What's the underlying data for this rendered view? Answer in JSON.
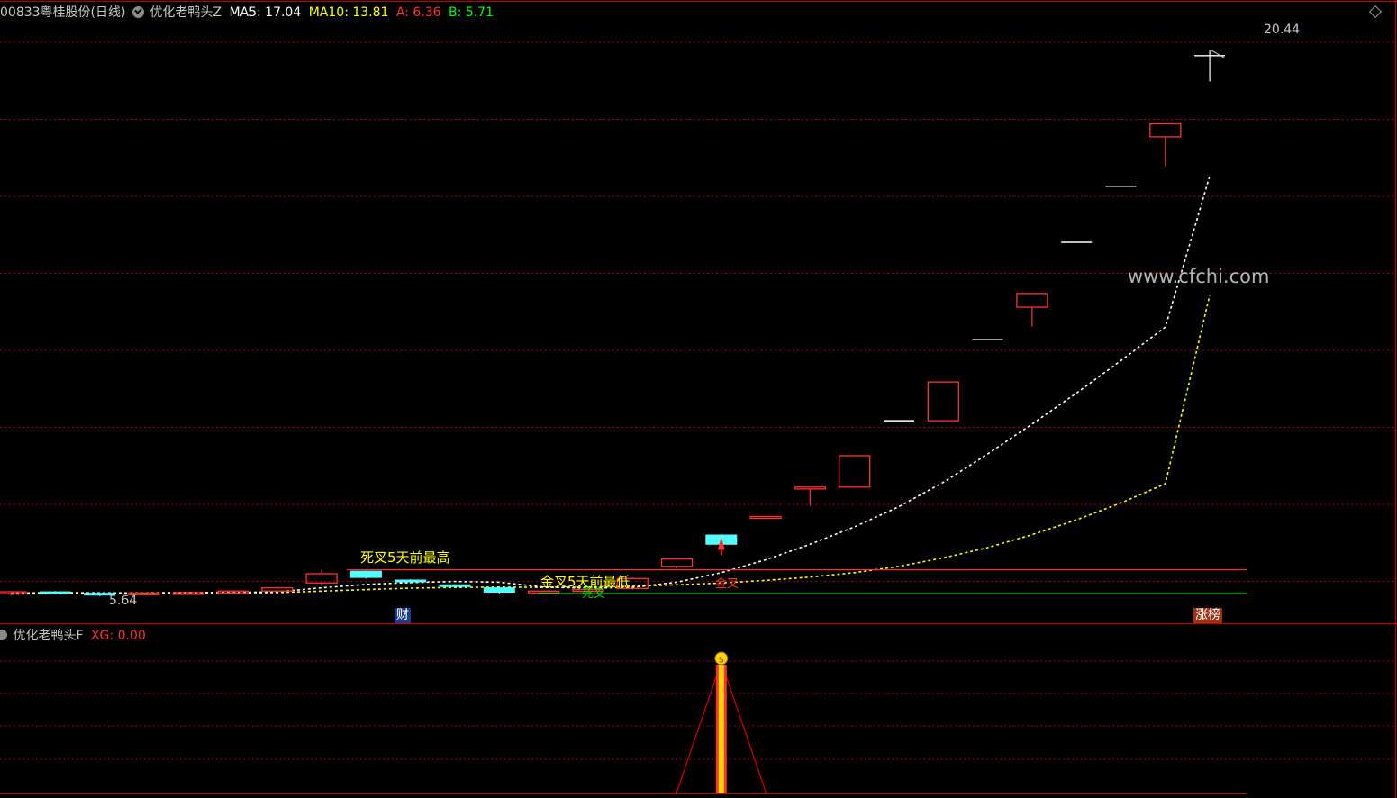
{
  "header": {
    "code": "00833",
    "stock_name": "粤桂股份",
    "period": "(日线)",
    "indicator_name": "优化老鸭头Z",
    "ma5_label": "MA5:",
    "ma5_value": "17.04",
    "ma10_label": "MA10:",
    "ma10_value": "13.81",
    "a_label": "A:",
    "a_value": "6.36",
    "b_label": "B:",
    "b_value": "5.71"
  },
  "sub_header": {
    "indicator_name": "优化老鸭头F",
    "xg_label": "XG:",
    "xg_value": "0.00"
  },
  "annotations": {
    "high_price": "20.44",
    "low_price": "5.64",
    "death_cross_label": "死叉5天前最高",
    "golden_cross_label": "金叉5天前最低",
    "death_cross_short": "死叉",
    "golden_cross_short": "金叉",
    "cai_tag": "财",
    "zhangbang_tag": "涨榜",
    "watermark": "www.cfchi.com"
  },
  "colors": {
    "background": "#000000",
    "up": "#ff3232",
    "down": "#54ffff",
    "flat": "#ffffff",
    "grid": "#a00000",
    "ma5": "#ffffff",
    "ma10": "#ffff00",
    "line_a": "#ff3232",
    "line_b": "#00ff00",
    "signal": "#ffd700"
  },
  "chart_data": {
    "type": "candlestick",
    "candles": [
      {
        "o": 5.73,
        "h": 5.78,
        "l": 5.66,
        "c": 5.76
      },
      {
        "o": 5.76,
        "h": 5.78,
        "l": 5.7,
        "c": 5.74
      },
      {
        "o": 5.72,
        "h": 5.74,
        "l": 5.64,
        "c": 5.7
      },
      {
        "o": 5.7,
        "h": 5.75,
        "l": 5.68,
        "c": 5.73
      },
      {
        "o": 5.72,
        "h": 5.76,
        "l": 5.7,
        "c": 5.74
      },
      {
        "o": 5.76,
        "h": 5.8,
        "l": 5.74,
        "c": 5.78
      },
      {
        "o": 5.78,
        "h": 5.9,
        "l": 5.76,
        "c": 5.87
      },
      {
        "o": 6.0,
        "h": 6.36,
        "l": 5.95,
        "c": 6.25
      },
      {
        "o": 6.32,
        "h": 6.34,
        "l": 6.12,
        "c": 6.15
      },
      {
        "o": 6.08,
        "h": 6.1,
        "l": 5.98,
        "c": 6.03
      },
      {
        "o": 5.95,
        "h": 5.97,
        "l": 5.88,
        "c": 5.92
      },
      {
        "o": 5.87,
        "h": 5.89,
        "l": 5.71,
        "c": 5.75
      },
      {
        "o": 5.74,
        "h": 5.8,
        "l": 5.71,
        "c": 5.78
      },
      {
        "o": 5.79,
        "h": 5.84,
        "l": 5.76,
        "c": 5.82
      },
      {
        "o": 5.85,
        "h": 6.15,
        "l": 5.82,
        "c": 6.12
      },
      {
        "o": 6.45,
        "h": 6.65,
        "l": 6.4,
        "c": 6.65
      },
      {
        "o": 7.3,
        "h": 7.32,
        "l": 6.95,
        "c": 7.05
      },
      {
        "o": 7.78,
        "h": 7.8,
        "l": 7.78,
        "c": 7.8
      },
      {
        "o": 8.55,
        "h": 8.6,
        "l": 8.1,
        "c": 8.6
      },
      {
        "o": 8.6,
        "h": 9.45,
        "l": 8.6,
        "c": 9.45
      },
      {
        "o": 10.4,
        "h": 10.4,
        "l": 10.4,
        "c": 10.4
      },
      {
        "o": 10.4,
        "h": 11.45,
        "l": 10.4,
        "c": 11.45
      },
      {
        "o": 12.6,
        "h": 12.6,
        "l": 12.6,
        "c": 12.6
      },
      {
        "o": 13.48,
        "h": 13.85,
        "l": 12.95,
        "c": 13.85
      },
      {
        "o": 15.24,
        "h": 15.24,
        "l": 15.24,
        "c": 15.24
      },
      {
        "o": 16.76,
        "h": 16.76,
        "l": 16.76,
        "c": 16.76
      },
      {
        "o": 18.1,
        "h": 18.45,
        "l": 17.3,
        "c": 18.45
      },
      {
        "o": 20.3,
        "h": 20.44,
        "l": 19.6,
        "c": 20.3
      }
    ],
    "ma5": [
      5.72,
      5.74,
      5.73,
      5.73,
      5.74,
      5.74,
      5.76,
      5.87,
      5.96,
      6.01,
      6.04,
      6.02,
      5.89,
      5.86,
      5.88,
      6.02,
      6.28,
      6.63,
      7.05,
      7.52,
      8.07,
      8.73,
      9.5,
      10.31,
      11.15,
      12.03,
      12.94,
      17.04
    ],
    "ma10": [
      5.7,
      5.71,
      5.72,
      5.72,
      5.73,
      5.73,
      5.74,
      5.78,
      5.82,
      5.86,
      5.88,
      5.89,
      5.88,
      5.89,
      5.91,
      5.95,
      6.0,
      6.07,
      6.16,
      6.28,
      6.45,
      6.68,
      6.96,
      7.31,
      7.71,
      8.17,
      8.69,
      13.81
    ],
    "line_a": 6.36,
    "line_b": 5.71,
    "ylim": [
      5.2,
      21.2
    ],
    "signal_index": 16
  }
}
